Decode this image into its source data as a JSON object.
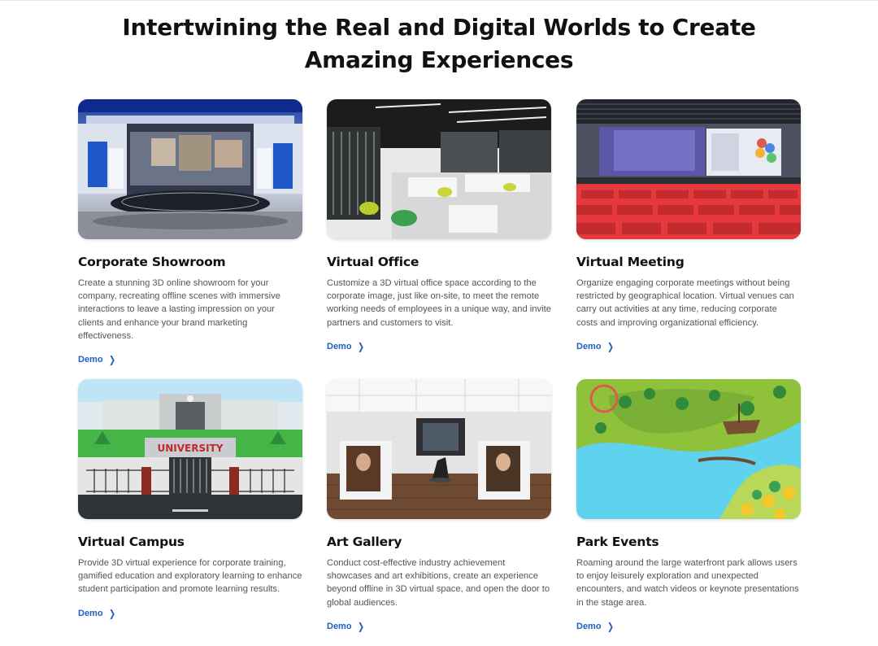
{
  "headline": "Intertwining the Real and Digital Worlds to Create Amazing Experiences",
  "accent_color": "#1f5fbf",
  "cards": [
    {
      "title": "Corporate Showroom",
      "description": "Create a stunning 3D online showroom for your company, recreating offline scenes with immersive interactions to leave a lasting impression on your clients and enhance your brand marketing effectiveness.",
      "demo_label": "Demo",
      "chevron_icon": "chevron-right-icon"
    },
    {
      "title": "Virtual Office",
      "description": "Customize a 3D virtual office space according to the corporate image, just like on-site, to meet the remote working needs of employees in a unique way, and invite partners and customers to visit.",
      "demo_label": "Demo",
      "chevron_icon": "chevron-right-icon"
    },
    {
      "title": "Virtual Meeting",
      "description": "Organize engaging corporate meetings without being restricted by geographical location. Virtual venues can carry out activities at any time, reducing corporate costs and improving organizational efficiency.",
      "demo_label": "Demo",
      "chevron_icon": "chevron-right-icon"
    },
    {
      "title": "Virtual Campus",
      "description": "Provide 3D virtual experience for corporate training, gamified education and exploratory learning to enhance student participation and promote learning results.",
      "demo_label": "Demo",
      "chevron_icon": "chevron-right-icon",
      "image_text": "UNIVERSITY"
    },
    {
      "title": "Art Gallery",
      "description": "Conduct cost-effective industry achievement showcases and art exhibitions, create an experience beyond offline in 3D virtual space, and open the door to global audiences.",
      "demo_label": "Demo",
      "chevron_icon": "chevron-right-icon"
    },
    {
      "title": "Park Events",
      "description": "Roaming around the large waterfront park allows users to enjoy leisurely exploration and unexpected encounters, and watch videos or keynote presentations in the stage area.",
      "demo_label": "Demo",
      "chevron_icon": "chevron-right-icon"
    }
  ]
}
